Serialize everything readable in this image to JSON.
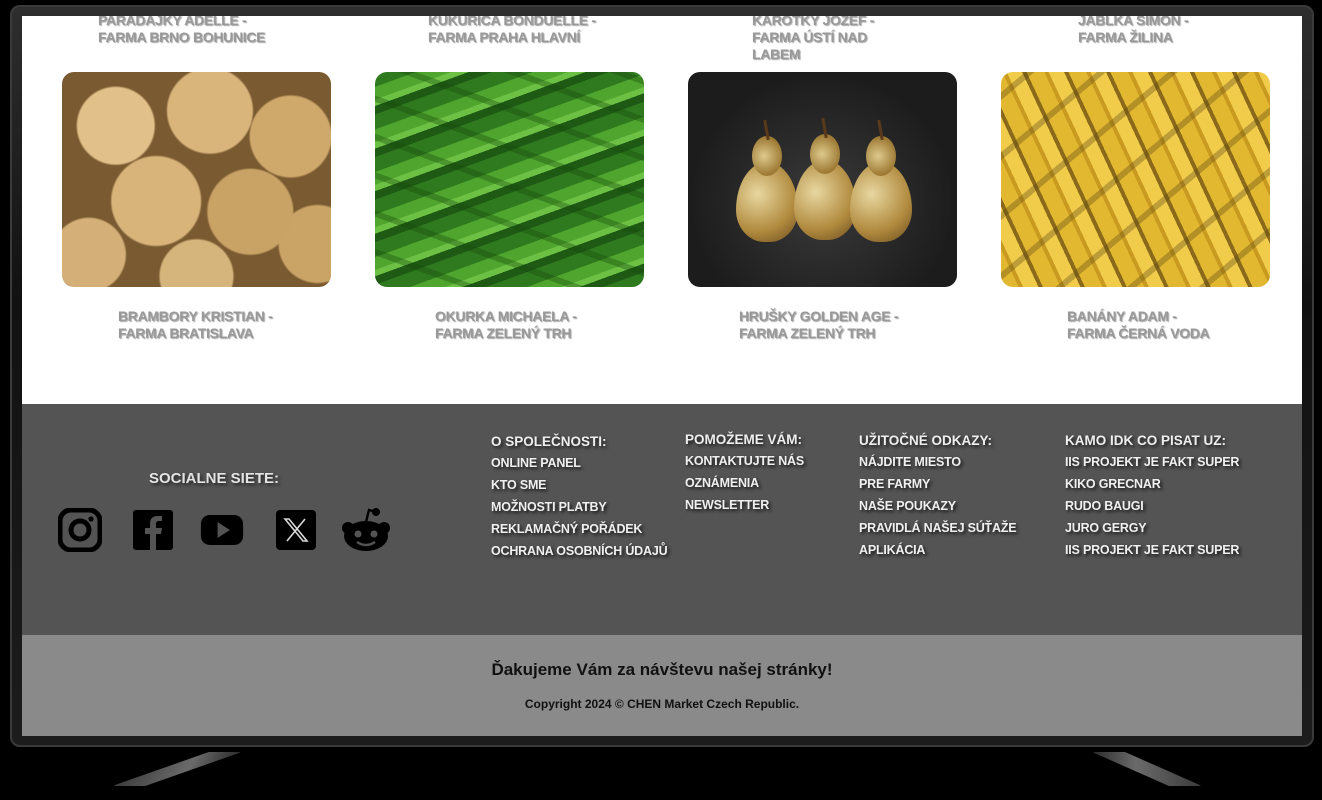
{
  "top_products": [
    {
      "line1": "PARADAJKY ADELLE -",
      "line2": "FARMA BRNO BOHUNICE",
      "line3": ""
    },
    {
      "line1": "KUKURICA BONDUELLE -",
      "line2": "FARMA PRAHA HLAVNÍ",
      "line3": ""
    },
    {
      "line1": "KAROTKY JOZEF -",
      "line2": "FARMA ÚSTÍ NAD",
      "line3": "LABEM"
    },
    {
      "line1": "JABLKA SIMON -",
      "line2": "FARMA ŽILINA",
      "line3": ""
    }
  ],
  "products": [
    {
      "line1": "BRAMBORY KRISTIAN -",
      "line2": "FARMA BRATISLAVA",
      "image": "potatoes"
    },
    {
      "line1": "OKURKA MICHAELA -",
      "line2": "FARMA ZELENÝ TRH",
      "image": "cucumbers"
    },
    {
      "line1": "HRUŠKY GOLDEN AGE -",
      "line2": "FARMA ZELENÝ TRH",
      "image": "pears"
    },
    {
      "line1": "BANÁNY ADAM -",
      "line2": "FARMA ČERNÁ VODA",
      "image": "bananas"
    }
  ],
  "footer": {
    "social_title": "SOCIALNE SIETE:",
    "social_icons": [
      "instagram-icon",
      "facebook-icon",
      "youtube-icon",
      "x-icon",
      "reddit-icon"
    ],
    "columns": [
      {
        "title": "O SPOLEČNOSTI:",
        "links": [
          "ONLINE PANEL",
          "KTO SME",
          "MOŽNOSTI PLATBY",
          "REKLAMAČNÝ POŘÁDEK",
          "OCHRANA OSOBNÍCH ÚDAJŮ"
        ]
      },
      {
        "title": "POMOŽEME VÁM:",
        "links": [
          "KONTAKTUJTE NÁS",
          "OZNÁMENIA",
          "NEWSLETTER"
        ]
      },
      {
        "title": "UŽITOČNÉ ODKAZY:",
        "links": [
          "NÁJDITE MIESTO",
          "PRE FARMY",
          "NAŠE POUKAZY",
          "PRAVIDLÁ NAŠEJ SÚŤAŽE",
          "APLIKÁCIA"
        ]
      },
      {
        "title": "KAMO IDK CO PISAT UZ:",
        "links": [
          "IIS PROJEKT JE FAKT SUPER",
          "KIKO GRECNAR",
          "RUDO BAUGI",
          "JURO GERGY",
          "IIS PROJEKT JE FAKT SUPER"
        ]
      }
    ]
  },
  "bottom": {
    "thanks": "Ďakujeme Vám za návštevu našej stránky!",
    "copyright": "Copyright 2024 © CHEN Market Czech Republic."
  },
  "colors": {
    "footer_bg": "#545454",
    "bottom_bg": "#8a8a8a",
    "title_gray": "#999999"
  }
}
